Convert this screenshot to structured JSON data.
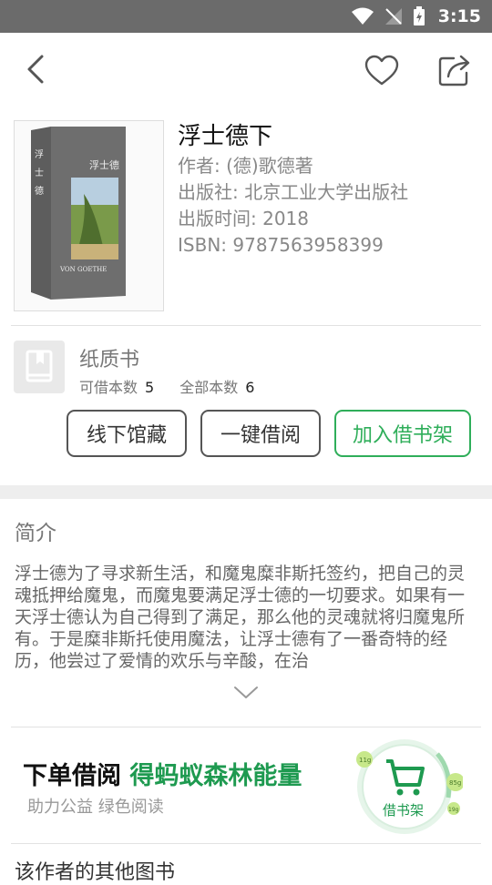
{
  "status_bar": {
    "time": "3:15"
  },
  "book": {
    "title": "浮士德下",
    "author": "作者:  (德)歌德著",
    "publisher": "出版社:  北京工业大学出版社",
    "pub_time": "出版时间:  2018",
    "isbn": "ISBN:  9787563958399",
    "cover_text_top": "浮士德",
    "cover_text_bottom": "VON GOETHE"
  },
  "paper": {
    "type_label": "纸质书",
    "available_label": "可借本数",
    "available_count": "5",
    "total_label": "全部本数",
    "total_count": "6",
    "buttons": {
      "offline": "线下馆藏",
      "borrow": "一键借阅",
      "add_shelf": "加入借书架"
    }
  },
  "intro": {
    "heading": "简介",
    "text": "浮士德为了寻求新生活，和魔鬼糜非斯托签约，把自己的灵魂抵押给魔鬼，而魔鬼要满足浮士德的一切要求。如果有一天浮士德认为自己得到了满足，那么他的灵魂就将归魔鬼所有。于是糜非斯托使用魔法，让浮士德有了一番奇特的经历，他尝过了爱情的欢乐与辛酸，在治"
  },
  "promo": {
    "line1_black": "下单借阅",
    "line1_green": "得蚂蚁森林能量",
    "line2": "助力公益 绿色阅读"
  },
  "fab": {
    "label": "借书架",
    "energy_1": "11g",
    "energy_2": "85g",
    "energy_3": "19g"
  },
  "others_heading": "该作者的其他图书",
  "colors": {
    "accent": "#2fae5a",
    "status_bar": "#6b6b6b"
  },
  "icons": [
    "back-icon",
    "heart-icon",
    "share-icon",
    "book-icon",
    "chevron-down-icon",
    "cart-icon"
  ]
}
